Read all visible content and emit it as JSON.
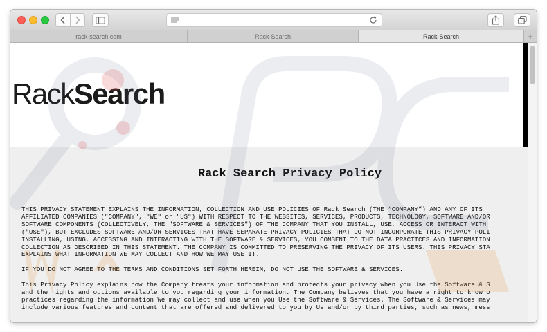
{
  "browser": {
    "tabs": [
      {
        "label": "rack-search.com",
        "active": false
      },
      {
        "label": "Rack-Search",
        "active": false
      },
      {
        "label": "Rack-Search",
        "active": true
      }
    ],
    "new_tab_label": "+"
  },
  "page": {
    "logo": {
      "part1": "Rack",
      "part2": "Search"
    },
    "title": "Rack Search Privacy Policy",
    "paragraphs": [
      "THIS PRIVACY STATEMENT EXPLAINS THE INFORMATION, COLLECTION AND USE POLICIES OF Rack Search (THE “COMPANY”) AND ANY OF ITS\nAFFILIATED COMPANIES (\"COMPANY\", \"WE\" or \"US\") WITH RESPECT TO THE WEBSITES, SERVICES, PRODUCTS, TECHNOLOGY, SOFTWARE AND/OR\nSOFTWARE COMPONENTS (COLLECTIVELY, THE \"SOFTWARE & SERVICES\") OF THE COMPANY THAT YOU INSTALL, USE, ACCESS OR INTERACT WITH\n(\"USE\"), BUT EXCLUDES SOFTWARE AND/OR SERVICES THAT HAVE SEPARATE PRIVACY POLICIES THAT DO NOT INCORPORATE THIS PRIVACY POLI\nINSTALLING, USING, ACCESSING AND INTERACTING WITH THE SOFTWARE & SERVICES, YOU CONSENT TO THE DATA PRACTICES AND INFORMATION\nCOLLECTION AS DESCRIBED IN THIS STATEMENT. THE COMPANY IS COMMITTED TO PRESERVING THE PRIVACY OF ITS USERS. THIS PRIVACY STA\nEXPLAINS WHAT INFORMATION WE MAY COLLECT AND HOW WE MAY USE IT.",
      "IF YOU DO NOT AGREE TO THE TERMS AND CONDITIONS SET FORTH HEREIN, DO NOT USE THE SOFTWARE & SERVICES.",
      "This Privacy Policy explains how the Company treats your information and protects your privacy when you Use the Software & S\nand the rights and options available to you regarding your information. The Company believes that you have a right to know o\npractices regarding the information We may collect and use when you Use the Software & Services. The Software & Services may\ninclude various features and content that are offered and delivered to you by Us and/or by third parties, such as news, mess"
    ]
  }
}
